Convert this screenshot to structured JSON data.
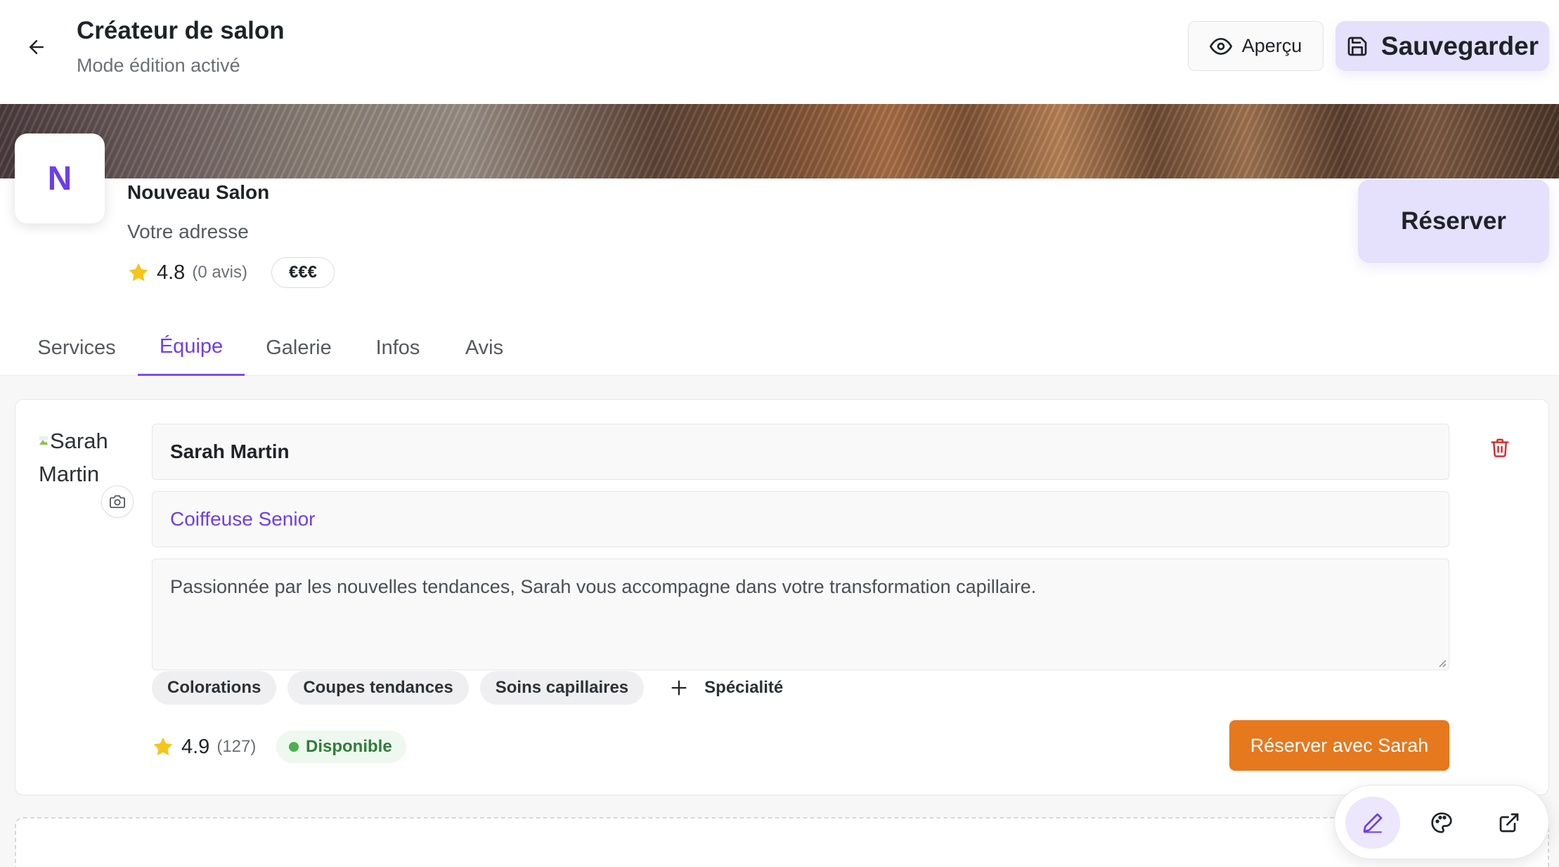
{
  "header": {
    "title": "Créateur de salon",
    "subtitle": "Mode édition activé",
    "preview_label": "Aperçu",
    "save_label": "Sauvegarder"
  },
  "salon": {
    "logo_letter": "N",
    "name": "Nouveau Salon",
    "address": "Votre adresse",
    "rating": "4.8",
    "reviews": "(0 avis)",
    "price_level": "€€€",
    "reserve_label": "Réserver"
  },
  "tabs": [
    {
      "label": "Services",
      "active": false
    },
    {
      "label": "Équipe",
      "active": true
    },
    {
      "label": "Galerie",
      "active": false
    },
    {
      "label": "Infos",
      "active": false
    },
    {
      "label": "Avis",
      "active": false
    }
  ],
  "member": {
    "photo_alt": "Sarah Martin",
    "name": "Sarah Martin",
    "role": "Coiffeuse Senior",
    "bio": "Passionnée par les nouvelles tendances, Sarah vous accompagne dans votre transformation capillaire.",
    "specialties": [
      "Colorations",
      "Coupes tendances",
      "Soins capillaires"
    ],
    "add_specialty_label": "Spécialité",
    "rating": "4.9",
    "reviews": "(127)",
    "status": "Disponible",
    "book_label": "Réserver avec Sarah"
  },
  "toolbar": {
    "icons": [
      "pencil-icon",
      "palette-icon",
      "external-link-icon"
    ]
  },
  "colors": {
    "accent": "#6d3fe6",
    "accent_soft": "#e5e0fb",
    "book_button": "#e6781e",
    "status_green": "#2f7d38",
    "star": "#f5c518",
    "delete": "#d32f2f"
  }
}
